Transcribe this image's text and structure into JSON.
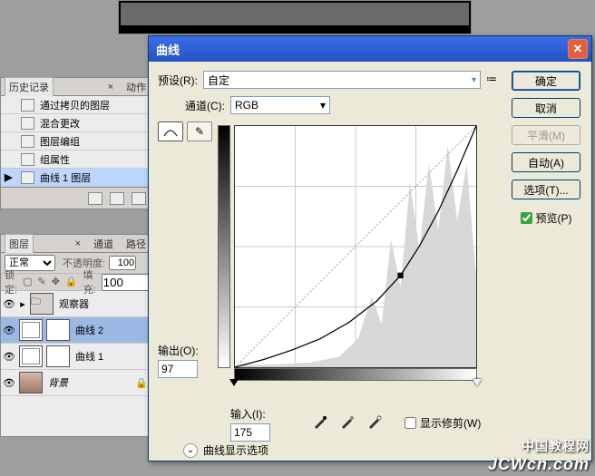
{
  "history": {
    "tabs": {
      "history": "历史记录",
      "actions": "动作"
    },
    "items": [
      {
        "label": "通过拷贝的图层"
      },
      {
        "label": "混合更改"
      },
      {
        "label": "图层编组"
      },
      {
        "label": "组属性"
      },
      {
        "label": "曲线 1 图层"
      }
    ]
  },
  "layers": {
    "tabs": {
      "layers": "图层",
      "channels": "通道",
      "paths": "路径"
    },
    "blend_mode": "正常",
    "opacity_label": "不透明度:",
    "opacity_value": "100",
    "lock_label": "锁定:",
    "fill_label": "填充:",
    "fill_value": "100",
    "group_name": "观察器",
    "layer_rows": [
      {
        "name": "曲线 2"
      },
      {
        "name": "曲线 1"
      },
      {
        "name": "背景"
      }
    ]
  },
  "dialog": {
    "title": "曲线",
    "preset_label": "预设(R):",
    "preset_value": "自定",
    "channel_label": "通道(C):",
    "channel_value": "RGB",
    "output_label": "输出(O):",
    "output_value": "97",
    "input_label": "输入(I):",
    "input_value": "175",
    "clip_label": "显示修剪(W)",
    "options_label": "曲线显示选项",
    "buttons": {
      "ok": "确定",
      "cancel": "取消",
      "smooth": "平滑(M)",
      "auto": "自动(A)",
      "options": "选项(T)...",
      "preview": "预览(P)"
    }
  },
  "chart_data": {
    "type": "line",
    "title": "曲线",
    "xlabel": "输入",
    "ylabel": "输出",
    "xlim": [
      0,
      255
    ],
    "ylim": [
      0,
      255
    ],
    "control_points": [
      {
        "x": 0,
        "y": 0
      },
      {
        "x": 175,
        "y": 97
      },
      {
        "x": 255,
        "y": 255
      }
    ],
    "curve_samples": [
      {
        "x": 0,
        "y": 0
      },
      {
        "x": 30,
        "y": 8
      },
      {
        "x": 60,
        "y": 18
      },
      {
        "x": 90,
        "y": 30
      },
      {
        "x": 120,
        "y": 47
      },
      {
        "x": 150,
        "y": 70
      },
      {
        "x": 175,
        "y": 97
      },
      {
        "x": 195,
        "y": 128
      },
      {
        "x": 215,
        "y": 165
      },
      {
        "x": 235,
        "y": 208
      },
      {
        "x": 255,
        "y": 255
      }
    ]
  },
  "watermark": {
    "cn": "中国教程网",
    "en": "JCWcn.com"
  }
}
